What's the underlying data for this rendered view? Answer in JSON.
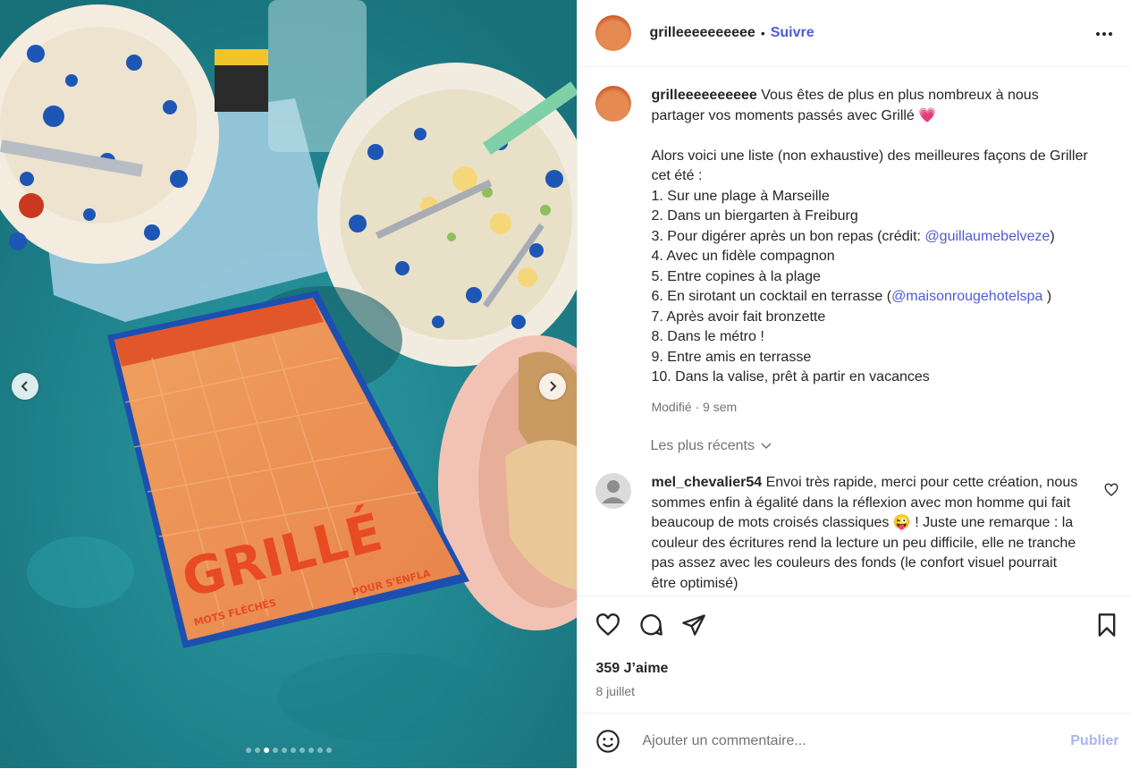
{
  "post": {
    "username": "grilleeeeeeeeee",
    "separator": "•",
    "follow_label": "Suivre",
    "more_icon": "more-horizontal-icon"
  },
  "caption": {
    "username": "grilleeeeeeeeee",
    "intro": "Vous êtes de plus en plus nombreux à nous partager vos moments passés avec Grillé 💗",
    "list_intro": "Alors voici une liste (non exhaustive) des meilleures façons de Griller cet été :",
    "items": [
      {
        "text": "1. Sur une plage à Marseille",
        "link": ""
      },
      {
        "text": "2. Dans un biergarten à Freiburg",
        "link": ""
      },
      {
        "text": "3. Pour digérer après un bon repas (crédit: ",
        "link": "@guillaumebelveze",
        "after": ")"
      },
      {
        "text": "4. Avec un fidèle compagnon",
        "link": ""
      },
      {
        "text": "5. Entre copines à la plage",
        "link": ""
      },
      {
        "text": "6. En sirotant un cocktail en terrasse (",
        "link": "@maisonrougehotelspa",
        "after": " )"
      },
      {
        "text": "7. Après avoir fait bronzette",
        "link": ""
      },
      {
        "text": "8. Dans le métro !",
        "link": ""
      },
      {
        "text": "9. Entre amis en terrasse",
        "link": ""
      },
      {
        "text": "10. Dans la valise, prêt à partir en vacances",
        "link": ""
      }
    ],
    "meta": "Modifié · 9 sem"
  },
  "sort_label": "Les plus récents",
  "comment": {
    "username": "mel_chevalier54",
    "text": "Envoi très rapide, merci pour cette création, nous sommes enfin à égalité dans la réflexion avec mon homme qui fait beaucoup de mots croisés classiques 😜 ! Juste une remarque : la couleur des écritures rend la lecture un peu difficile, elle ne tranche pas assez avec les couleurs des fonds (le confort visuel pourrait être optimisé)"
  },
  "stats": {
    "likes": "359 J’aime",
    "date": "8 juillet"
  },
  "add_comment": {
    "placeholder": "Ajouter un commentaire...",
    "publish_label": "Publier"
  },
  "carousel": {
    "dot_count": 10,
    "active_index": 2,
    "booklet_title": "GRILLÉ",
    "booklet_subtitle_left": "MOTS FLÉCHÉS",
    "booklet_subtitle_right": "POUR S'ENFLA"
  },
  "colors": {
    "accent_link": "#4f5bd5",
    "muted": "#737373",
    "table": "#1f8b95"
  }
}
